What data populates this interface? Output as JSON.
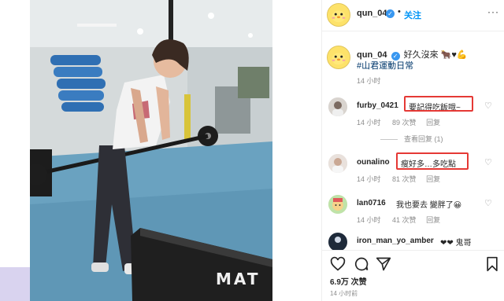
{
  "post": {
    "username": "qun_04",
    "dot": "•",
    "follow_label": "关注",
    "more_label": "···",
    "caption_text": "好久沒來",
    "caption_emojis": "🐂♥💪",
    "hashtag": "#山君運動日常",
    "caption_time": "14 小时",
    "likes_total": "6.9万 次赞",
    "post_time": "14 小时前"
  },
  "comments": [
    {
      "username": "furby_0421",
      "text": "要記得吃飯哦~",
      "time": "14 小时",
      "likes": "89 次赞",
      "reply": "回复"
    },
    {
      "username": "ounalino",
      "text": "瘦好多…多吃點",
      "time": "14 小时",
      "likes": "81 次赞",
      "reply": "回复"
    },
    {
      "username": "lan0716",
      "text": "我也要去 變胖了😀",
      "time": "14 小时",
      "likes": "41 次赞",
      "reply": "回复"
    },
    {
      "username": "iron_man_yo_amber",
      "text": "❤❤ 鬼哥",
      "time": "",
      "likes": "",
      "reply": ""
    }
  ],
  "view_replies": "查看回复 (1)",
  "photo": {
    "machine_text": "MAT"
  },
  "colors": {
    "follow_blue": "#0095f6",
    "highlight_red": "#e53935",
    "hashtag": "#00376b",
    "avatar_yellow": "#fde26a"
  }
}
